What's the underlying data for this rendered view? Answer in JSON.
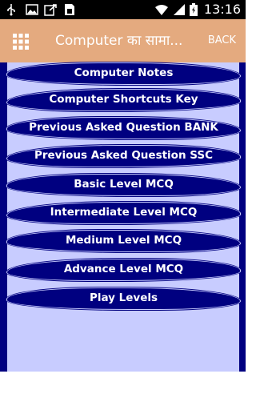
{
  "status_bar": {
    "time": "13:16",
    "icons": [
      "usb-icon",
      "image-icon",
      "share-icon",
      "sim-card-icon",
      "wifi-icon",
      "signal-icon",
      "battery-icon"
    ]
  },
  "action_bar": {
    "title": "Computer का सामा...",
    "back_label": "BACK",
    "menu_icon": "grid-menu-icon"
  },
  "menu": {
    "items": [
      {
        "label": "Computer Notes"
      },
      {
        "label": "Computer Shortcuts Key"
      },
      {
        "label": "Previous Asked Question BANK"
      },
      {
        "label": "Previous Asked Question SSC"
      },
      {
        "label": "Basic Level MCQ"
      },
      {
        "label": "Intermediate Level MCQ"
      },
      {
        "label": "Medium Level MCQ"
      },
      {
        "label": "Advance Level MCQ"
      },
      {
        "label": "Play Levels"
      }
    ]
  },
  "colors": {
    "action_bar": "#e4aa7f",
    "button_bg": "#000080",
    "content_bg": "#c8ccff"
  }
}
